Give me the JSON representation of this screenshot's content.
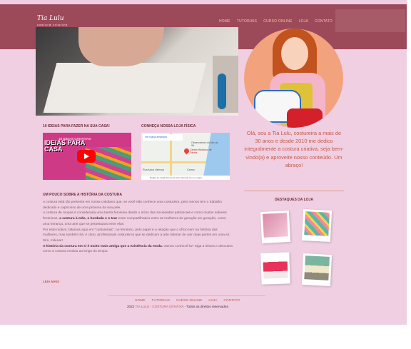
{
  "header": {
    "logo_title": "Tia Lulu",
    "logo_subtitle": "costura criativa",
    "nav": [
      "HOME",
      "TUTORIAIS",
      "CURSO ONLINE",
      "LOJA",
      "CONTATO"
    ]
  },
  "about_text": "Olá, sou a Tia Lulu, costureira a mais de 30 anos e desde 2010 me dedico integralmente a costura criativa, seja bem-vindo(a) e aproveite nosso conteúdo. Um abraço!",
  "sections": {
    "video_title": "10 IDEIAS PARA FAZER NA SUA CASA!",
    "store_title": "CONHEÇA NOSSA LOJA FÍSICA",
    "history_title": "UM POUCO SOBRE A HISTÓRIA DA COSTURA",
    "highlights_title": "DESTAQUES DA LOJA"
  },
  "video": {
    "channel": "10 IDEIAS CRIATIVAS",
    "overlay_text": "IDEIAS PARA CASA"
  },
  "map": {
    "link_text": "Ver mapa ampliado",
    "place": "Centro Histórico de Olinda",
    "labels": [
      "Observatório do Alto da Sé",
      "Rua Acios Valença",
      "Carmo"
    ],
    "footer_text": "Dados do mapa   Termos de Uso   Informar erro no mapa"
  },
  "history": {
    "p1": "A costura está tão presente em nossa cotidiano que, se você não conhece uma costureira, pelo menos tem o trabalho dedicado e capricioso de uma próxima da sua pele.",
    "p2a": "A costura de roupas é considerada uma tarefa feminina desde o início das sociedades patriarcais e como muitos saberes femininos, ",
    "p2b": "a costura à mão, o bordado e o tear",
    "p2c": " eram compartilhados entre as mulheres de geração em geração, como uma herança, uma arte que se perpetuava entre elas.",
    "p3": "Por este motivo, falamos aqui em \"costureiras\", no feminino, pelo papel e a relação que o ofício tem na história das mulheres, mas também há, é claro, profissionais costureiros que se dedicam a arte milenar de unir duas partes em uma só. Sim, milenar!",
    "p4a": "A história da costura em si é muito mais antiga que a existência da moda.",
    "p4b": " Vamos conhecê-la? Siga a leitura e descubra como a costura evoluiu ao longo do tempo.",
    "read_more": "LEIA MAIS"
  },
  "footer": {
    "nav": [
      "HOME",
      "TUTORIAIS",
      "CURSO ONLINE",
      "LOJA",
      "CONTATO"
    ],
    "year": "2022",
    "brand": "TIA LULU - COSTURA CRIATIVA",
    "rights": "- Todos os direitos reservados."
  },
  "colors": {
    "header": "#9c4a5a",
    "background": "#f0cfe2",
    "accent": "#c55a48"
  }
}
